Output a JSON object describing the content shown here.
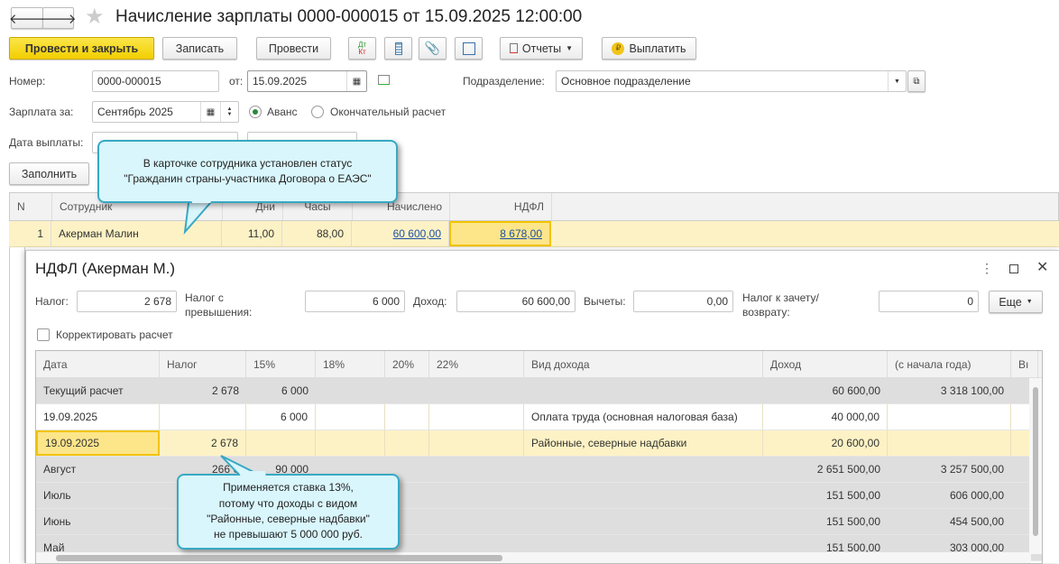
{
  "title": "Начисление зарплаты 0000-000015 от 15.09.2025 12:00:00",
  "toolbar": {
    "post_close": "Провести и закрыть",
    "save": "Записать",
    "post": "Провести",
    "reports": "Отчеты",
    "pay": "Выплатить",
    "dtkt_dt": "Дт",
    "dtkt_kt": "Кт"
  },
  "form": {
    "number_label": "Номер:",
    "number": "0000-000015",
    "from_label": "от:",
    "date": "15.09.2025",
    "dept_label": "Подразделение:",
    "dept": "Основное подразделение",
    "salary_label": "Зарплата за:",
    "salary_month": "Сентябрь 2025",
    "radio_advance": "Аванс",
    "radio_final": "Окончательный расчет",
    "radio_selected": "Аванс",
    "paydate_label": "Дата выплаты:",
    "fill": "Заполнить"
  },
  "main_table": {
    "headers": [
      "N",
      "Сотрудник",
      "Дни",
      "Часы",
      "Начислено",
      "НДФЛ"
    ],
    "rows": [
      {
        "n": "1",
        "employee": "Акерман Малин",
        "days": "11,00",
        "hours": "88,00",
        "accrued": "60 600,00",
        "ndfl": "8 678,00"
      }
    ]
  },
  "callout1": {
    "line1": "В карточке сотрудника установлен статус",
    "line2": "\"Гражданин страны-участника Договора о ЕАЭС\""
  },
  "popup": {
    "title": "НДФЛ (Акерман М.)",
    "tax_label": "Налог:",
    "tax": "2 678",
    "excess_label": "Налог с превышения:",
    "excess": "6 000",
    "income_label": "Доход:",
    "income": "60 600,00",
    "deductions_label": "Вычеты:",
    "deductions": "0,00",
    "offset_label": "Налог к зачету/возврату:",
    "offset": "0",
    "more": "Еще",
    "correct_label": "Корректировать расчет",
    "correct_checked": false,
    "headers": [
      "Дата",
      "Налог",
      "15%",
      "18%",
      "20%",
      "22%",
      "Вид дохода",
      "Доход",
      "(с начала года)",
      "Вı"
    ],
    "rows": [
      {
        "date": "Текущий расчет",
        "tax": "2 678",
        "p15": "6 000",
        "kind": "",
        "income": "60 600,00",
        "ytd": "3 318 100,00",
        "style": "gray"
      },
      {
        "date": "19.09.2025",
        "tax": "",
        "p15": "6 000",
        "kind": "Оплата труда (основная налоговая база)",
        "income": "40 000,00",
        "ytd": "",
        "style": "white"
      },
      {
        "date": "19.09.2025",
        "tax": "2 678",
        "p15": "",
        "kind": "Районные, северные надбавки",
        "income": "20 600,00",
        "ytd": "",
        "style": "selected"
      },
      {
        "date": "Август",
        "tax": "266 6",
        "p15": "90 000",
        "kind": "",
        "income": "2 651 500,00",
        "ytd": "3 257 500,00",
        "style": "gray"
      },
      {
        "date": "Июль",
        "tax": "",
        "p15": "",
        "kind": "",
        "income": "151 500,00",
        "ytd": "606 000,00",
        "style": "gray"
      },
      {
        "date": "Июнь",
        "tax": "",
        "p15": "",
        "kind": "",
        "income": "151 500,00",
        "ytd": "454 500,00",
        "style": "gray"
      },
      {
        "date": "Май",
        "tax": "",
        "p15": "",
        "kind": "",
        "income": "151 500,00",
        "ytd": "303 000,00",
        "style": "gray"
      }
    ]
  },
  "callout2": {
    "line1": "Применяется ставка 13%,",
    "line2": "потому что доходы с видом",
    "line3": "\"Районные, северные надбавки\"",
    "line4": "не превышают 5 000 000 руб."
  },
  "colors": {
    "accent_yellow": "#f5d800",
    "selected_row": "#fdf2c5",
    "callout_bg": "#d9f6fc",
    "callout_border": "#37a9c4"
  }
}
